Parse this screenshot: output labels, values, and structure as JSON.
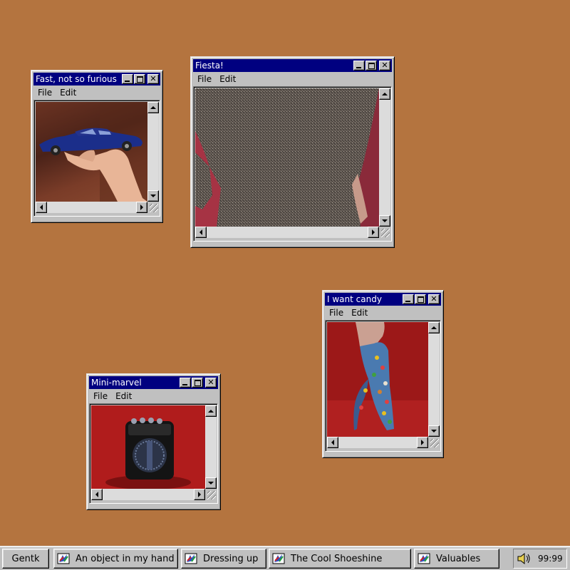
{
  "windows": [
    {
      "id": "w1",
      "title": "Fast, not so furious",
      "menu": [
        "File",
        "Edit"
      ],
      "image": "blue toy car held in hand"
    },
    {
      "id": "w2",
      "title": "Fiesta!",
      "menu": [
        "File",
        "Edit"
      ],
      "image": "glittery grey sweater"
    },
    {
      "id": "w3",
      "title": "I want candy",
      "menu": [
        "File",
        "Edit"
      ],
      "image": "colorful patterned sock on foot"
    },
    {
      "id": "w4",
      "title": "Mini-marvel",
      "menu": [
        "File",
        "Edit"
      ],
      "image": "small black amplifier"
    }
  ],
  "taskbar": {
    "start_label": "Gentk",
    "tasks": [
      {
        "label": "An object in my hand",
        "icon": "app-icon"
      },
      {
        "label": "Dressing up",
        "icon": "app-icon"
      },
      {
        "label": "The Cool Shoeshine",
        "icon": "app-icon"
      },
      {
        "label": "Valuables",
        "icon": "app-icon"
      }
    ],
    "tray_time": "99:99",
    "tray_icon": "speaker-icon"
  },
  "colors": {
    "desktop": "#b4743f",
    "titlebar": "#000080",
    "chrome": "#c0c0c0"
  }
}
